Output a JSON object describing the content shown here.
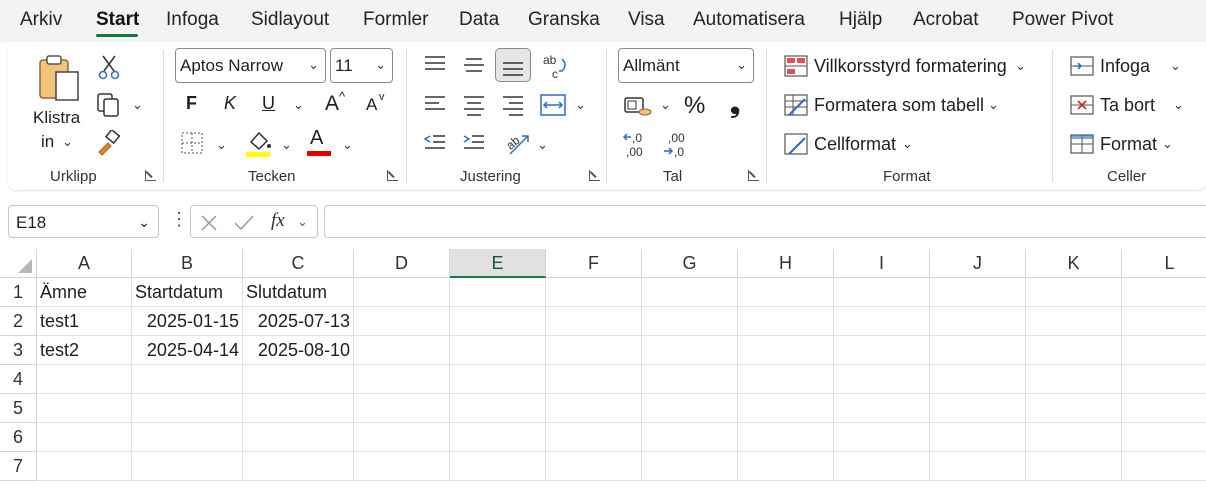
{
  "menu": {
    "tabs": [
      "Arkiv",
      "Start",
      "Infoga",
      "Sidlayout",
      "Formler",
      "Data",
      "Granska",
      "Visa",
      "Automatisera",
      "Hjälp",
      "Acrobat",
      "Power Pivot"
    ],
    "active": "Start"
  },
  "ribbon": {
    "clipboard": {
      "paste_label_1": "Klistra",
      "paste_label_2": "in",
      "group": "Urklipp"
    },
    "font": {
      "name": "Aptos Narrow",
      "size": "11",
      "bold": "F",
      "italic": "K",
      "underline": "U",
      "grow": "A",
      "shrink": "A",
      "fill_color": "#ffff00",
      "font_color": "#e00000",
      "group": "Tecken"
    },
    "alignment": {
      "group": "Justering",
      "wrap_icon_text": "ab c"
    },
    "number": {
      "format": "Allmänt",
      "percent": "%",
      "comma": "❟",
      "inc_decimals": ",0 ,00",
      "dec_decimals": ",00 ,0",
      "group": "Tal"
    },
    "styles": {
      "conditional": "Villkorsstyrd formatering",
      "as_table": "Formatera som tabell",
      "cell_styles": "Cellformat",
      "group": "Format"
    },
    "cells": {
      "insert": "Infoga",
      "delete": "Ta bort",
      "format": "Format",
      "group": "Celler"
    }
  },
  "formula_bar": {
    "name_box": "E18",
    "fx": "fx",
    "formula": ""
  },
  "sheet": {
    "columns": [
      "A",
      "B",
      "C",
      "D",
      "E",
      "F",
      "G",
      "H",
      "I",
      "J",
      "K",
      "L"
    ],
    "selected_column": "E",
    "rows": [
      "1",
      "2",
      "3",
      "4",
      "5",
      "6",
      "7"
    ],
    "cells": [
      [
        "Ämne",
        "Startdatum",
        "Slutdatum"
      ],
      [
        "test1",
        "2025-01-15",
        "2025-07-13"
      ],
      [
        "test2",
        "2025-04-14",
        "2025-08-10"
      ]
    ]
  },
  "colors": {
    "accent": "#107c41"
  }
}
